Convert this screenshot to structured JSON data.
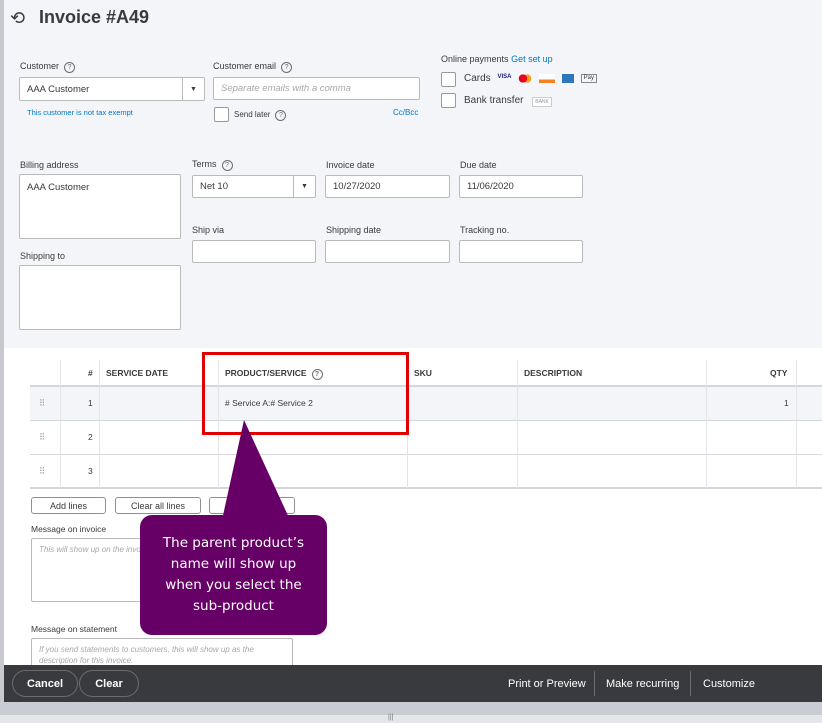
{
  "header": {
    "title": "Invoice #A49",
    "icon": "history-icon"
  },
  "customer": {
    "label": "Customer",
    "value": "AAA Customer",
    "tax_note": "This customer is not tax exempt"
  },
  "email": {
    "label": "Customer email",
    "placeholder": "Separate emails with a comma",
    "send_later": "Send later",
    "cc_bcc": "Cc/Bcc"
  },
  "payments": {
    "label": "Online payments",
    "setup_link": "Get set up",
    "cards": "Cards",
    "card_brands": [
      "VISA",
      "MC",
      "DISC",
      "AMEX",
      "Pay"
    ],
    "bank": "Bank transfer",
    "bank_badge": "BANK"
  },
  "billing": {
    "label": "Billing address",
    "value": "AAA Customer"
  },
  "shipping_to": {
    "label": "Shipping to",
    "value": ""
  },
  "terms": {
    "label": "Terms",
    "value": "Net 10"
  },
  "invoice_date": {
    "label": "Invoice date",
    "value": "10/27/2020"
  },
  "due_date": {
    "label": "Due date",
    "value": "11/06/2020"
  },
  "ship_via": {
    "label": "Ship via",
    "value": ""
  },
  "shipping_date": {
    "label": "Shipping date",
    "value": ""
  },
  "tracking": {
    "label": "Tracking no.",
    "value": ""
  },
  "table": {
    "columns": [
      "#",
      "SERVICE DATE",
      "PRODUCT/SERVICE",
      "SKU",
      "DESCRIPTION",
      "QTY"
    ],
    "rows": [
      {
        "num": "1",
        "product": "# Service A:# Service 2",
        "qty": "1"
      },
      {
        "num": "2",
        "product": "",
        "qty": ""
      },
      {
        "num": "3",
        "product": "",
        "qty": ""
      }
    ]
  },
  "actions": {
    "add_lines": "Add lines",
    "clear_lines": "Clear all lines",
    "add_subtotal": "Add subtotal"
  },
  "message_invoice": {
    "label": "Message on invoice",
    "placeholder": "This will show up on the invoice."
  },
  "message_statement": {
    "label": "Message on statement",
    "placeholder": "If you send statements to customers, this will show up as the description for this invoice."
  },
  "callout": {
    "text": "The parent product’s name will show up when you select the sub-product",
    "color": "#660066",
    "highlight": "#e00000"
  },
  "footer": {
    "cancel": "Cancel",
    "clear": "Clear",
    "print": "Print or Preview",
    "recurring": "Make recurring",
    "customize": "Customize"
  }
}
